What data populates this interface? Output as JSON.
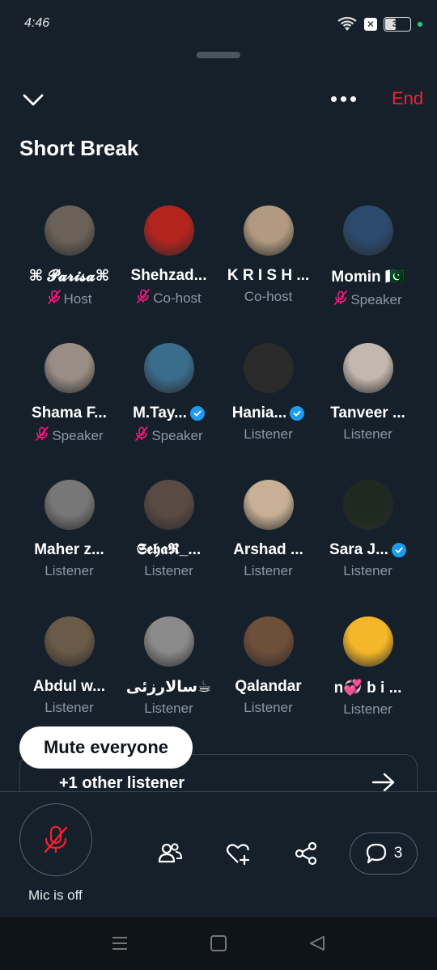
{
  "status_bar": {
    "time": "4:46",
    "battery": "38"
  },
  "top": {
    "end_label": "End"
  },
  "space": {
    "title": "Short Break"
  },
  "participants": [
    {
      "name": "⌘ 𝓟𝓪𝓻𝓲𝓼𝓪⌘",
      "role": "Host",
      "muted": true,
      "verified": false,
      "avatar_color": "#6b6158"
    },
    {
      "name": "Shehzad...",
      "role": "Co-host",
      "muted": true,
      "verified": false,
      "avatar_color": "#b3241f"
    },
    {
      "name": "K R I S H ...",
      "role": "Co-host",
      "muted": false,
      "verified": false,
      "avatar_color": "#b29a80"
    },
    {
      "name": "Momin 🇵🇰",
      "role": "Speaker",
      "muted": true,
      "verified": false,
      "avatar_color": "#2b4a6e"
    },
    {
      "name": "Shama F...",
      "role": "Speaker",
      "muted": true,
      "verified": false,
      "avatar_color": "#9a8d86"
    },
    {
      "name": "M.Tay...",
      "role": "Speaker",
      "muted": true,
      "verified": true,
      "avatar_color": "#3a6c8c"
    },
    {
      "name": "Hania...",
      "role": "Listener",
      "muted": false,
      "verified": true,
      "avatar_color": "#2a2a2a"
    },
    {
      "name": "Tanveer ...",
      "role": "Listener",
      "muted": false,
      "verified": false,
      "avatar_color": "#c4b8ae"
    },
    {
      "name": "Maher z...",
      "role": "Listener",
      "muted": false,
      "verified": false,
      "avatar_color": "#777777"
    },
    {
      "name": "𝕾𝖊𝖍𝖆𝕽_...",
      "role": "Listener",
      "muted": false,
      "verified": false,
      "avatar_color": "#5a4a44"
    },
    {
      "name": "Arshad ...",
      "role": "Listener",
      "muted": false,
      "verified": false,
      "avatar_color": "#c7b095"
    },
    {
      "name": "Sara J...",
      "role": "Listener",
      "muted": false,
      "verified": true,
      "avatar_color": "#1e2a1f"
    },
    {
      "name": "Abdul w...",
      "role": "Listener",
      "muted": false,
      "verified": false,
      "avatar_color": "#6a5a48"
    },
    {
      "name": "سالارزئی☕",
      "role": "Listener",
      "muted": false,
      "verified": false,
      "avatar_color": "#8a8a8a"
    },
    {
      "name": "Qalandar",
      "role": "Listener",
      "muted": false,
      "verified": false,
      "avatar_color": "#6e4f3a"
    },
    {
      "name": "n💞 b i ...",
      "role": "Listener",
      "muted": false,
      "verified": false,
      "avatar_color": "#f5b728"
    }
  ],
  "mute_everyone_label": "Mute everyone",
  "other_listener_label": "+1 other listener",
  "bottom": {
    "mic_label": "Mic is off",
    "chat_count": "3"
  },
  "colors": {
    "accent_end": "#f4212e",
    "muted_icon": "#f91880",
    "verified": "#1d9bf0",
    "bg": "#15202b"
  }
}
